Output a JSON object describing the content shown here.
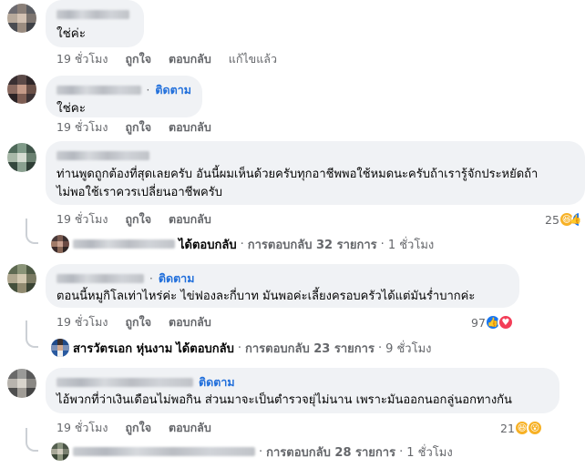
{
  "colors": {
    "bubble": "#f0f2f5",
    "follow": "#216fdb",
    "meta": "#65676b",
    "text": "#050505"
  },
  "comments": [
    {
      "text": "ใช่ค่ะ",
      "time": "19 ชั่วโมง",
      "like": "ถูกใจ",
      "reply": "ตอบกลับ",
      "edited": "แก้ไขแล้ว"
    },
    {
      "follow": "ติดตาม",
      "text": "ใช่คะ",
      "time": "19 ชั่วโมง",
      "like": "ถูกใจ",
      "reply": "ตอบกลับ"
    },
    {
      "text": "ท่านพูดถูกต้องที่สุดเลยครับ อันนี้ผมเห็นด้วยครับทุกอาชีพพอใช้หมดนะครับถ้าเรารู้จักประหยัดถ้า\nไม่พอใช้เราควรเปลี่ยนอาชีพครับ",
      "time": "19 ชั่วโมง",
      "like": "ถูกใจ",
      "reply": "ตอบกลับ",
      "reaction_count": "25",
      "reactions": [
        "haha-icon",
        "like-icon"
      ],
      "replies": {
        "replied": "ได้ตอบกลับ",
        "sep1": "·",
        "count": "การตอบกลับ 32 รายการ",
        "sep2": "·",
        "time": "1 ชั่วโมง"
      }
    },
    {
      "follow": "ติดตาม",
      "text": "ตอนนี้หมูกิโลเท่าไหร่ค่ะ ไข่ฟองละกี่บาท มันพอค่ะเลี้ยงครอบครัวได้แต่มันร่ำบากค่ะ",
      "time": "19 ชั่วโมง",
      "like": "ถูกใจ",
      "reply": "ตอบกลับ",
      "reaction_count": "97",
      "reactions": [
        "like-icon",
        "love-icon"
      ],
      "replies": {
        "who": "สารวัตรเอก หุ่นงาม",
        "replied": "ได้ตอบกลับ",
        "sep1": "·",
        "count": "การตอบกลับ 23 รายการ",
        "sep2": "·",
        "time": "9 ชั่วโมง"
      }
    },
    {
      "follow": "ติดตาม",
      "text": "ไอ้พวกที่ว่าเงินเดือนไม่พอกิน ส่วนมาจะเป็นตำรวจยุ่ไม่นาน เพราะมันออกนอกลู่นอกทางกัน",
      "time": "19 ชั่วโมง",
      "like": "ถูกใจ",
      "reply": "ตอบกลับ",
      "reaction_count": "21",
      "reactions": [
        "haha-icon",
        "wow-icon"
      ],
      "replies": {
        "sep1": "·",
        "count": "การตอบกลับ 28 รายการ",
        "sep2": "·",
        "time": "1 ชั่วโมง"
      }
    }
  ]
}
